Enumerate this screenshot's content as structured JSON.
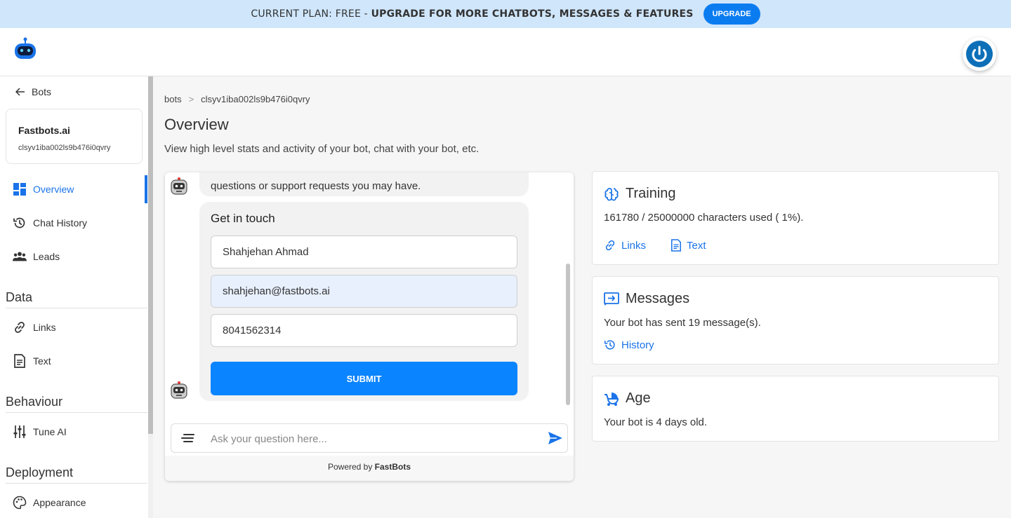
{
  "banner": {
    "prefix": "CURRENT PLAN: FREE - ",
    "bold": "UPGRADE FOR MORE CHATBOTS, MESSAGES & FEATURES",
    "button": "UPGRADE"
  },
  "sidebar": {
    "back_label": "Bots",
    "bot": {
      "name": "Fastbots.ai",
      "id": "clsyv1iba002ls9b476i0qvry"
    },
    "nav": [
      {
        "label": "Overview",
        "icon": "dashboard-icon"
      },
      {
        "label": "Chat History",
        "icon": "history-icon"
      },
      {
        "label": "Leads",
        "icon": "people-icon"
      }
    ],
    "data_section": "Data",
    "data_items": [
      {
        "label": "Links",
        "icon": "link-icon"
      },
      {
        "label": "Text",
        "icon": "document-icon"
      }
    ],
    "behaviour_section": "Behaviour",
    "behaviour_items": [
      {
        "label": "Tune AI",
        "icon": "tune-icon"
      }
    ],
    "deployment_section": "Deployment",
    "deployment_items": [
      {
        "label": "Appearance",
        "icon": "palette-icon"
      }
    ]
  },
  "breadcrumb": {
    "root": "bots",
    "sep": ">",
    "current": "clsyv1iba002ls9b476i0qvry"
  },
  "page": {
    "title": "Overview",
    "subtitle": "View high level stats and activity of your bot, chat with your bot, etc."
  },
  "chat": {
    "partial_message": "questions or support requests you may have.",
    "form": {
      "title": "Get in touch",
      "name_value": "Shahjehan Ahmad",
      "email_value": "shahjehan@fastbots.ai",
      "phone_value": "8041562314",
      "submit": "SUBMIT"
    },
    "input_placeholder": "Ask your question here...",
    "powered_prefix": "Powered by ",
    "powered_brand": "FastBots"
  },
  "training": {
    "title": "Training",
    "usage": "161780 / 25000000 characters used ( 1%).",
    "links_label": "Links",
    "text_label": "Text"
  },
  "messages": {
    "title": "Messages",
    "text": "Your bot has sent 19 message(s).",
    "history_label": "History"
  },
  "age": {
    "title": "Age",
    "text": "Your bot is 4 days old."
  },
  "colors": {
    "accent": "#1a73e8",
    "banner_bg": "#cfe6fb",
    "submit": "#0a84ff"
  }
}
